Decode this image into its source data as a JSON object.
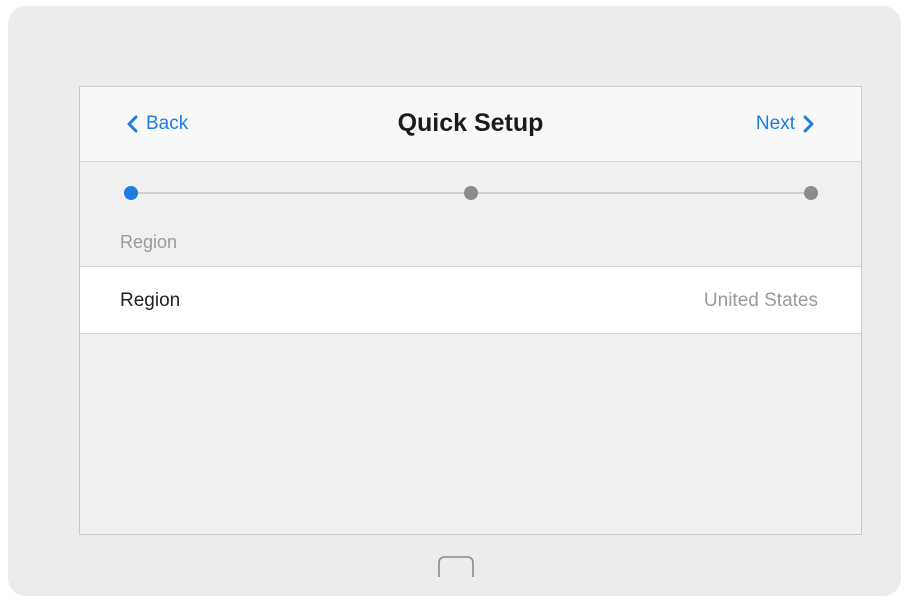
{
  "header": {
    "back_label": "Back",
    "title": "Quick Setup",
    "next_label": "Next"
  },
  "progress": {
    "steps": 3,
    "current_step": 1,
    "current_step_label": "Region"
  },
  "settings": {
    "rows": [
      {
        "label": "Region",
        "value": "United States"
      }
    ]
  },
  "colors": {
    "accent": "#1f7de0",
    "inactive_dot": "#8c8c8c"
  },
  "icons": {
    "back": "chevron-left-icon",
    "next": "chevron-right-icon",
    "home": "home-button-icon"
  }
}
